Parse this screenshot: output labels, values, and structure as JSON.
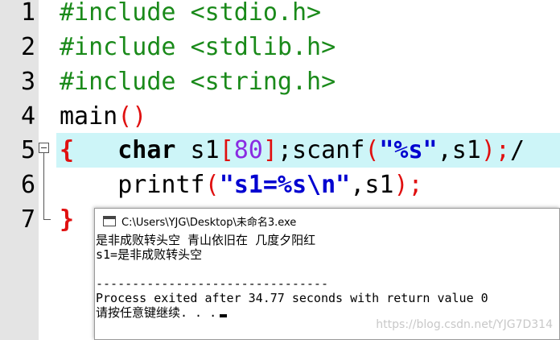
{
  "editor": {
    "line_numbers": [
      "1",
      "2",
      "3",
      "4",
      "5",
      "6",
      "7"
    ],
    "lines": {
      "l1": {
        "directive": "#include",
        "header": "<stdio.h>"
      },
      "l2": {
        "directive": "#include",
        "header": "<stdlib.h>"
      },
      "l3": {
        "directive": "#include",
        "header": "<string.h>"
      },
      "l4": {
        "func": "main",
        "parens": "()"
      },
      "l5": {
        "open_brace": "{",
        "indent": "   ",
        "kw_char": "char",
        "s1a": " s1",
        "lbr": "[",
        "num": "80",
        "rbr": "]",
        "semi1": ";",
        "scanf": "scanf",
        "lp": "(",
        "fmt": "\"%s\"",
        "comma": ",",
        "s1b": "s1",
        "rp": ")",
        "semi2": ";",
        "trail": "/"
      },
      "l6": {
        "indent": "    ",
        "printf": "printf",
        "lp": "(",
        "fmt": "\"s1=%s\\n\"",
        "comma": ",",
        "s1": "s1",
        "rp": ")",
        "semi": ";"
      },
      "l7": {
        "close_brace": "}"
      }
    }
  },
  "console": {
    "title": "C:\\Users\\YJG\\Desktop\\未命名3.exe",
    "lines": [
      "是非成败转头空 青山依旧在 几度夕阳红",
      "s1=是非成败转头空",
      "",
      "--------------------------------",
      "Process exited after 34.77 seconds with return value 0",
      "请按任意键继续. . ."
    ]
  },
  "watermark": "https://blog.csdn.net/YJG7D314",
  "colors": {
    "preprocessor": "#1a8a1a",
    "bracket": "#e01010",
    "string": "#0000d0",
    "number": "#8a2be2",
    "current_line": "#cdf5f8",
    "gutter": "#e4e4e4"
  }
}
